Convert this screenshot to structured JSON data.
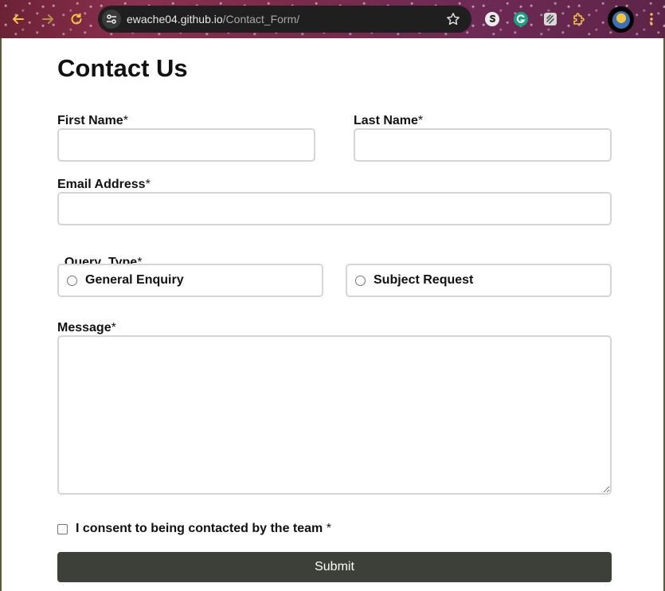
{
  "browser": {
    "url_domain": "ewache04.github.io",
    "url_path": "/Contact_Form/",
    "back_icon": "arrow-left-icon",
    "forward_icon": "arrow-right-icon",
    "reload_icon": "reload-icon",
    "star_icon": "star-icon",
    "extensions": [
      "s-extension-icon",
      "grammarly-icon",
      "notes-extension-icon",
      "puzzle-icon"
    ],
    "accent_color": "#f2c53d"
  },
  "form": {
    "title": "Contact Us",
    "first_name_label": "First Name",
    "last_name_label": "Last Name",
    "email_label": "Email Address",
    "query_type_label": "Query  Type",
    "query_options": [
      "General Enquiry",
      "Subject Request"
    ],
    "message_label": "Message",
    "required_marker": "*",
    "consent_label": "I consent to being contacted by the team",
    "consent_marker": " *",
    "submit_label": "Submit",
    "first_name_value": "",
    "last_name_value": "",
    "email_value": "",
    "message_value": "",
    "submit_color": "#3c4039"
  }
}
